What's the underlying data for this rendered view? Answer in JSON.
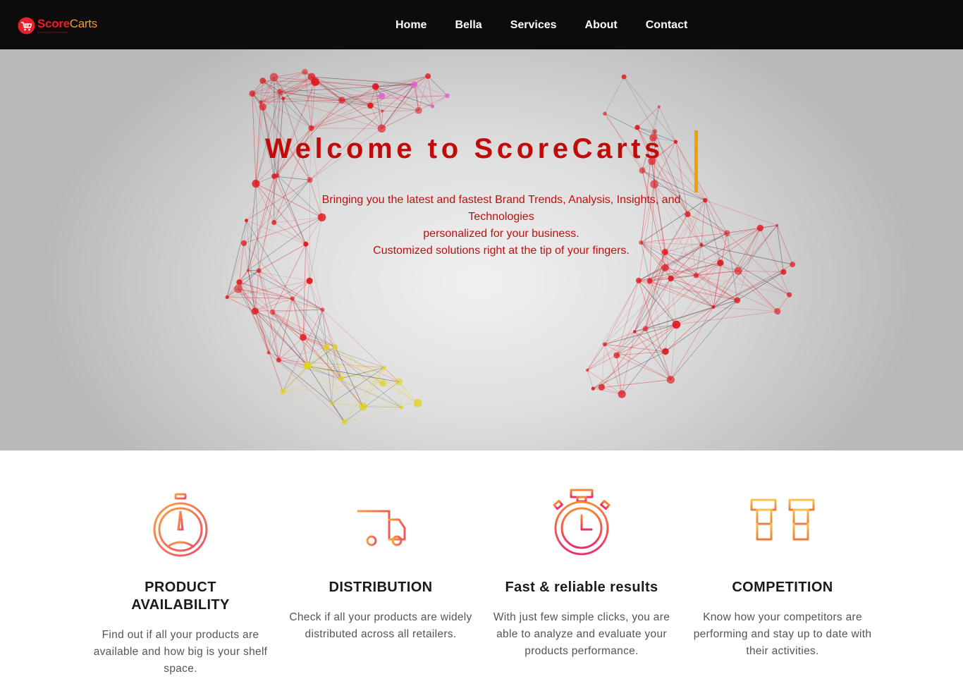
{
  "brand": {
    "name_part1": "Score",
    "name_part2": "Carts",
    "tagline": "Delivering Information"
  },
  "nav": {
    "items": [
      {
        "label": "Home"
      },
      {
        "label": "Bella"
      },
      {
        "label": "Services"
      },
      {
        "label": "About"
      },
      {
        "label": "Contact"
      }
    ]
  },
  "hero": {
    "title": "Welcome to ScoreCarts",
    "lines": [
      "Bringing you the latest and fastest Brand Trends, Analysis, Insights, and",
      "Technologies",
      "personalized for your business.",
      "Customized solutions right at the tip of your fingers."
    ]
  },
  "features": [
    {
      "icon": "stopwatch-gauge-icon",
      "title": "PRODUCT AVAILABILITY",
      "desc": "Find out if all your products are available and how big is your shelf space."
    },
    {
      "icon": "delivery-truck-icon",
      "title": "DISTRIBUTION",
      "desc": "Check if all your products are widely distributed across all retailers."
    },
    {
      "icon": "timer-clock-icon",
      "title": "Fast & reliable results",
      "desc": "With just few simple clicks, you are able to analyze and evaluate your products performance."
    },
    {
      "icon": "competitors-icon",
      "title": "COMPETITION",
      "desc": "Know how your competitors are performing and stay up to date with their activities."
    }
  ],
  "colors": {
    "nav_bg": "#0d0b0b",
    "accent_red": "#c10b0b",
    "accent_orange": "#f09a2f",
    "cursor": "#f0a100"
  }
}
